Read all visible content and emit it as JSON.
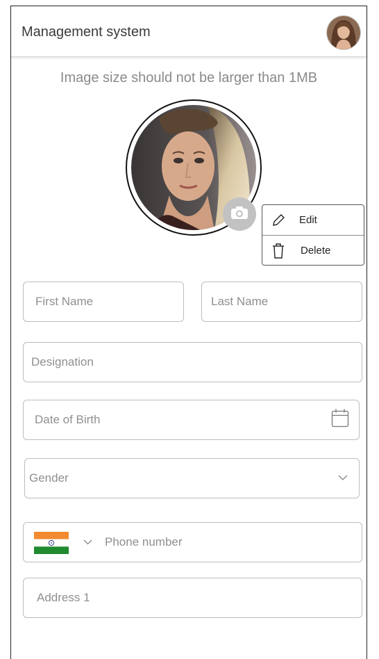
{
  "header": {
    "title": "Management system",
    "avatar_icon": "user-avatar-icon"
  },
  "upload": {
    "hint": "Image size should not be larger than 1MB",
    "camera_icon": "camera-icon"
  },
  "photo_menu": {
    "items": [
      {
        "label": "Edit",
        "icon": "pencil-icon"
      },
      {
        "label": "Delete",
        "icon": "trash-icon"
      }
    ]
  },
  "form": {
    "first_name": {
      "placeholder": "First Name",
      "value": ""
    },
    "last_name": {
      "placeholder": "Last Name",
      "value": ""
    },
    "designation": {
      "placeholder": "Designation",
      "value": ""
    },
    "dob": {
      "placeholder": "Date of Birth",
      "value": "",
      "icon": "calendar-icon"
    },
    "gender": {
      "placeholder": "Gender",
      "selected": "",
      "icon": "chevron-down-icon"
    },
    "phone": {
      "placeholder": "Phone number",
      "value": "",
      "country_flag": "india-flag-icon"
    },
    "address1": {
      "placeholder": "Address 1",
      "value": ""
    }
  },
  "colors": {
    "border": "#bdbdbd",
    "placeholder": "#8f8f8f",
    "camera_bg": "#c2c2c2",
    "flag_saffron": "#f28b30",
    "flag_green": "#1f8a2f",
    "flag_chakra": "#2b3a8c"
  }
}
